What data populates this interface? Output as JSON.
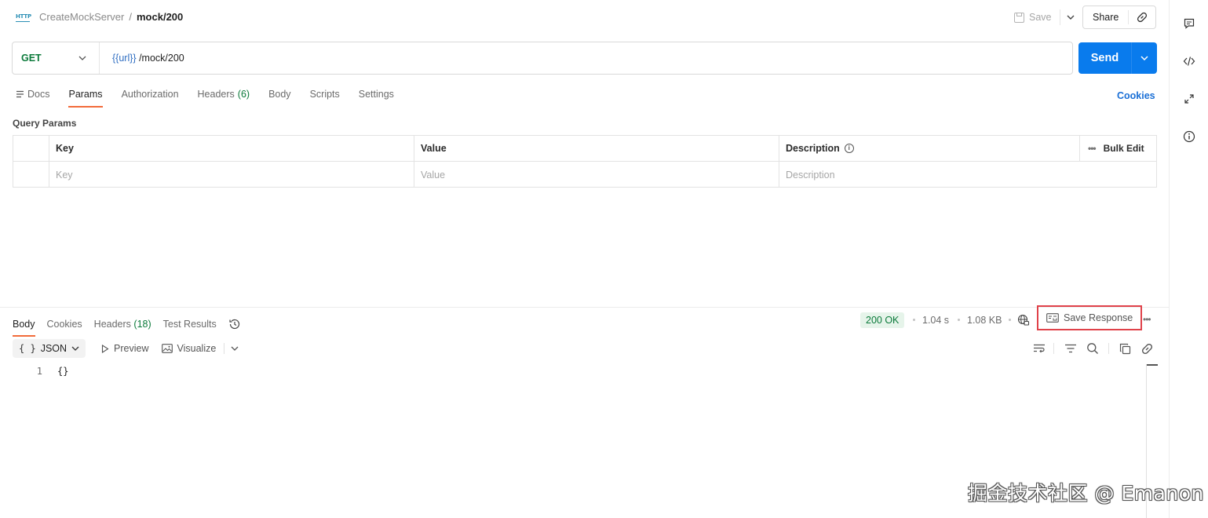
{
  "header": {
    "protocol_badge": "HTTP",
    "breadcrumb_parent": "CreateMockServer",
    "breadcrumb_sep": "/",
    "breadcrumb_current": "mock/200",
    "save_label": "Save",
    "share_label": "Share"
  },
  "request": {
    "method": "GET",
    "url_variable": "{{url}}",
    "url_path": " /mock/200",
    "send_label": "Send"
  },
  "request_tabs": [
    {
      "label": "Docs"
    },
    {
      "label": "Params"
    },
    {
      "label": "Authorization"
    },
    {
      "label": "Headers",
      "count": "(6)"
    },
    {
      "label": "Body"
    },
    {
      "label": "Scripts"
    },
    {
      "label": "Settings"
    }
  ],
  "cookies_link": "Cookies",
  "query_params": {
    "title": "Query Params",
    "columns": {
      "key": "Key",
      "value": "Value",
      "description": "Description"
    },
    "bulk_edit": "Bulk Edit",
    "placeholders": {
      "key": "Key",
      "value": "Value",
      "description": "Description"
    }
  },
  "response": {
    "tabs": [
      {
        "label": "Body"
      },
      {
        "label": "Cookies"
      },
      {
        "label": "Headers",
        "count": "(18)"
      },
      {
        "label": "Test Results"
      }
    ],
    "status": "200 OK",
    "time": "1.04 s",
    "size": "1.08 KB",
    "save_response": "Save Response",
    "format": "JSON",
    "preview_label": "Preview",
    "visualize_label": "Visualize",
    "code_lines": [
      {
        "no": "1",
        "text": "{}"
      }
    ]
  },
  "watermark": "掘金技术社区 @ Emanon",
  "colors": {
    "send": "#097bed",
    "method": "#0b7a3a",
    "active_tab": "#f26b3a",
    "status_bg": "#e6f4ea",
    "highlight_box": "#e0424a"
  }
}
